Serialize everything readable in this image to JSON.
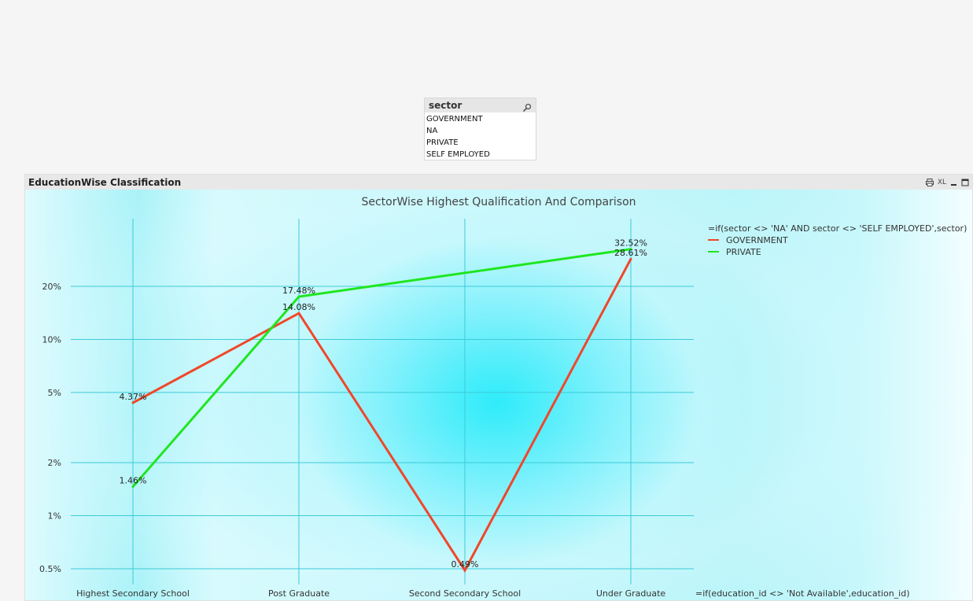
{
  "listbox": {
    "title": "sector",
    "icon": "search-icon",
    "items": [
      "GOVERNMENT",
      "NA",
      "PRIVATE",
      "SELF EMPLOYED"
    ]
  },
  "panel": {
    "title": "EducationWise  Classification",
    "controls": {
      "print_icon": "printer-icon",
      "xl_label": "XL",
      "minimize_icon": "minimize-icon",
      "maximize_icon": "maximize-icon"
    }
  },
  "chart_data": {
    "type": "line",
    "title": "SectorWise Highest Qualification And Comparison",
    "xlabel": "=if(education_id <> 'Not Available',education_id)",
    "ylabel": "",
    "y_scale": "log",
    "y_ticks": [
      "0.5%",
      "1%",
      "2%",
      "5%",
      "10%",
      "20%"
    ],
    "y_tick_values": [
      0.5,
      1,
      2,
      5,
      10,
      20
    ],
    "ylim": [
      0.45,
      40
    ],
    "grid": true,
    "categories": [
      "Highest Secondary School",
      "Post Graduate",
      "Second Secondary School",
      "Under Graduate"
    ],
    "legend": {
      "title": "=if(sector <> 'NA' AND sector <> 'SELF EMPLOYED',sector)",
      "position": "top-right"
    },
    "series": [
      {
        "name": "GOVERNMENT",
        "color": "#f0472a",
        "values": [
          4.37,
          14.08,
          0.49,
          28.61
        ],
        "labels": [
          "4.37%",
          "14.08%",
          "0.49%",
          "28.61%"
        ]
      },
      {
        "name": "PRIVATE",
        "color": "#1fe61f",
        "values": [
          1.46,
          17.48,
          null,
          32.52
        ],
        "labels": [
          "1.46%",
          "17.48%",
          null,
          "32.52%"
        ]
      }
    ]
  }
}
